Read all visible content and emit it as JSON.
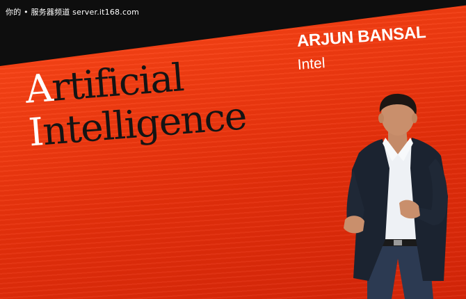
{
  "watermark": {
    "text": "你的 • 服务器频道 server.it168.com"
  },
  "slide": {
    "title_line1_cap": "A",
    "title_line1_rest": "rtificial",
    "title_line2_cap": "I",
    "title_line2_rest": "ntelligence",
    "speaker_name": "ARJUN BANSAL",
    "speaker_org": "Intel"
  },
  "colors": {
    "slide_background": "#f03a10",
    "title_text": "#141414",
    "accent_white": "#ffffff",
    "top_band": "#0e0e0e",
    "suit": "#1b2330",
    "shirt": "#eef1f5",
    "jeans": "#2c3a52"
  },
  "presenter": {
    "description_icon": "person-speaking-icon"
  }
}
